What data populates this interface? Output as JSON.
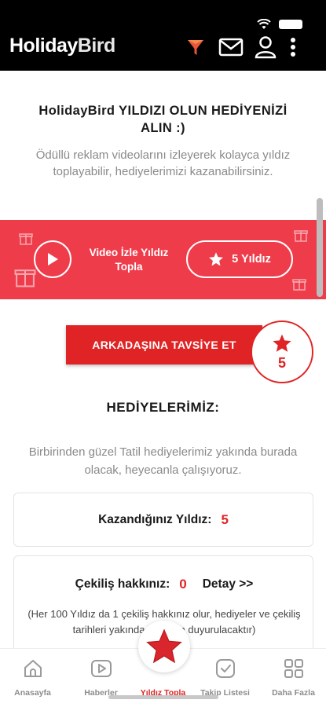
{
  "header": {
    "brand_part1": "Holiday",
    "brand_part2": "Bird",
    "accent_color": "#e02425",
    "icons": [
      "filter-icon",
      "mail-icon",
      "user-icon",
      "more-vertical-icon"
    ]
  },
  "intro": {
    "title": "HolidayBird YILDIZI OLUN HEDİYENİZİ ALIN :)",
    "text": "Ödüllü reklam videolarını izleyerek kolayca yıldız toplayabilir, hediyelerimizi kazanabilirsiniz."
  },
  "promo_band": {
    "background": "#ef3c4b",
    "video_label": "Video İzle Yıldız Topla",
    "stars_label": "5 Yıldız"
  },
  "recommend": {
    "button_label": "ARKADAŞINA TAVSİYE ET",
    "star_count": "5"
  },
  "gifts": {
    "title": "HEDİYELERİMİZ:",
    "text": "Birbirinden güzel Tatil hediyelerimiz yakında burada olacak, heyecanla çalışıyoruz."
  },
  "earned_card": {
    "label": "Kazandığınız Yıldız:",
    "value": "5"
  },
  "draw_card": {
    "label": "Çekiliş hakkınız:",
    "value": "0",
    "detail_label": "Detay >>",
    "note": "(Her 100 Yıldız da 1 çekiliş hakkınız olur, hediyeler ve çekiliş tarihleri yakında buradan duyurulacaktır)"
  },
  "bottom_nav": {
    "items": [
      {
        "label": "Anasayfa",
        "icon": "home-icon"
      },
      {
        "label": "Haberler",
        "icon": "play-icon"
      },
      {
        "label": "Yıldız Topla",
        "icon": "star-icon",
        "active": true
      },
      {
        "label": "Takip Listesi",
        "icon": "checklist-icon"
      },
      {
        "label": "Daha Fazla",
        "icon": "grid-icon"
      }
    ]
  }
}
